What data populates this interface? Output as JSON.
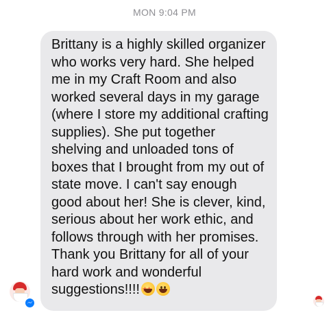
{
  "timestamp": "MON 9:04 PM",
  "message": {
    "lines": [
      "Brittany is a highly skilled organizer",
      "who works very hard.  She helped",
      "me in my Craft Room and also",
      "worked several days in my garage",
      "(where I store my additional crafting",
      "supplies).  She put together",
      "shelving and unloaded tons of",
      "boxes that I brought from my out of",
      "state move.  I can't say enough",
      "good about her!  She is clever, kind,",
      "serious about her work ethic, and",
      "follows through with her promises.",
      "Thank you Brittany for all of your",
      "hard work and wonderful",
      "suggestions!!!!"
    ],
    "emojis": [
      "star-struck-emoji",
      "grinning-face-emoji"
    ]
  },
  "icons": {
    "sender_avatar": "santa-avatar-icon",
    "messenger_badge": "messenger-icon",
    "read_receipt": "santa-avatar-icon",
    "brand_color": "#0a7cff",
    "bubble_color": "#e9e9eb"
  }
}
